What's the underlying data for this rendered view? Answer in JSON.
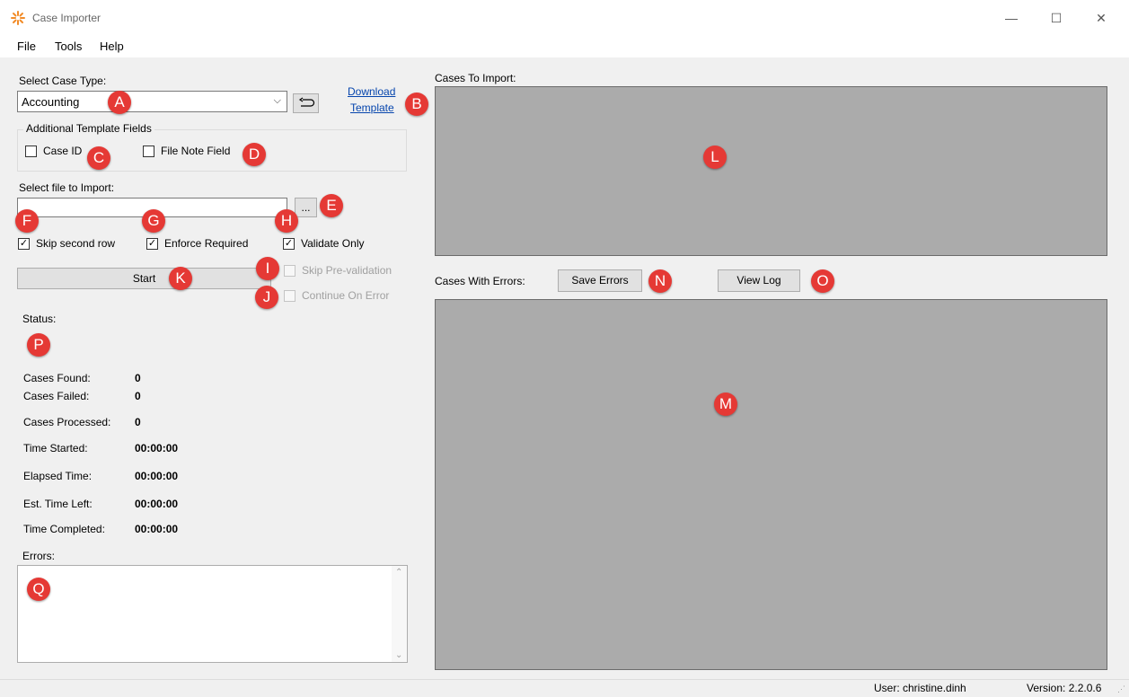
{
  "window": {
    "title": "Case Importer",
    "controls": {
      "minimize": "—",
      "maximize": "☐",
      "close": "✕"
    }
  },
  "menu": [
    "File",
    "Tools",
    "Help"
  ],
  "case_type": {
    "label": "Select Case Type:",
    "value": "Accounting",
    "download_link": [
      "Download",
      "Template"
    ]
  },
  "additional_fields": {
    "legend": "Additional Template Fields",
    "case_id": "Case ID",
    "file_note": "File Note Field"
  },
  "file_import": {
    "label": "Select file to Import:",
    "value": "",
    "browse_label": "..."
  },
  "options": {
    "skip_second_row": "Skip second row",
    "enforce_required": "Enforce Required",
    "validate_only": "Validate Only",
    "skip_prevalidation": "Skip Pre-validation",
    "continue_on_error": "Continue On Error"
  },
  "start_label": "Start",
  "status": {
    "label": "Status:",
    "rows": [
      {
        "label": "Cases Found:",
        "value": "0"
      },
      {
        "label": "Cases Failed:",
        "value": "0"
      },
      {
        "label": "Cases Processed:",
        "value": "0"
      },
      {
        "label": "Time Started:",
        "value": "00:00:00"
      },
      {
        "label": "Elapsed Time:",
        "value": "00:00:00"
      },
      {
        "label": "Est. Time Left:",
        "value": "00:00:00"
      },
      {
        "label": "Time Completed:",
        "value": "00:00:00"
      }
    ]
  },
  "errors_label": "Errors:",
  "cases_to_import_label": "Cases To Import:",
  "cases_with_errors_label": "Cases With Errors:",
  "save_errors_label": "Save Errors",
  "view_log_label": "View Log",
  "markers": {
    "A": "A",
    "B": "B",
    "C": "C",
    "D": "D",
    "E": "E",
    "F": "F",
    "G": "G",
    "H": "H",
    "I": "I",
    "J": "J",
    "K": "K",
    "L": "L",
    "M": "M",
    "N": "N",
    "O": "O",
    "P": "P",
    "Q": "Q"
  },
  "footer": {
    "user": "User: christine.dinh",
    "version": "Version: 2.2.0.6"
  },
  "colors": {
    "accent": "#e53935",
    "panel": "#ababab",
    "link": "#0645ad"
  }
}
